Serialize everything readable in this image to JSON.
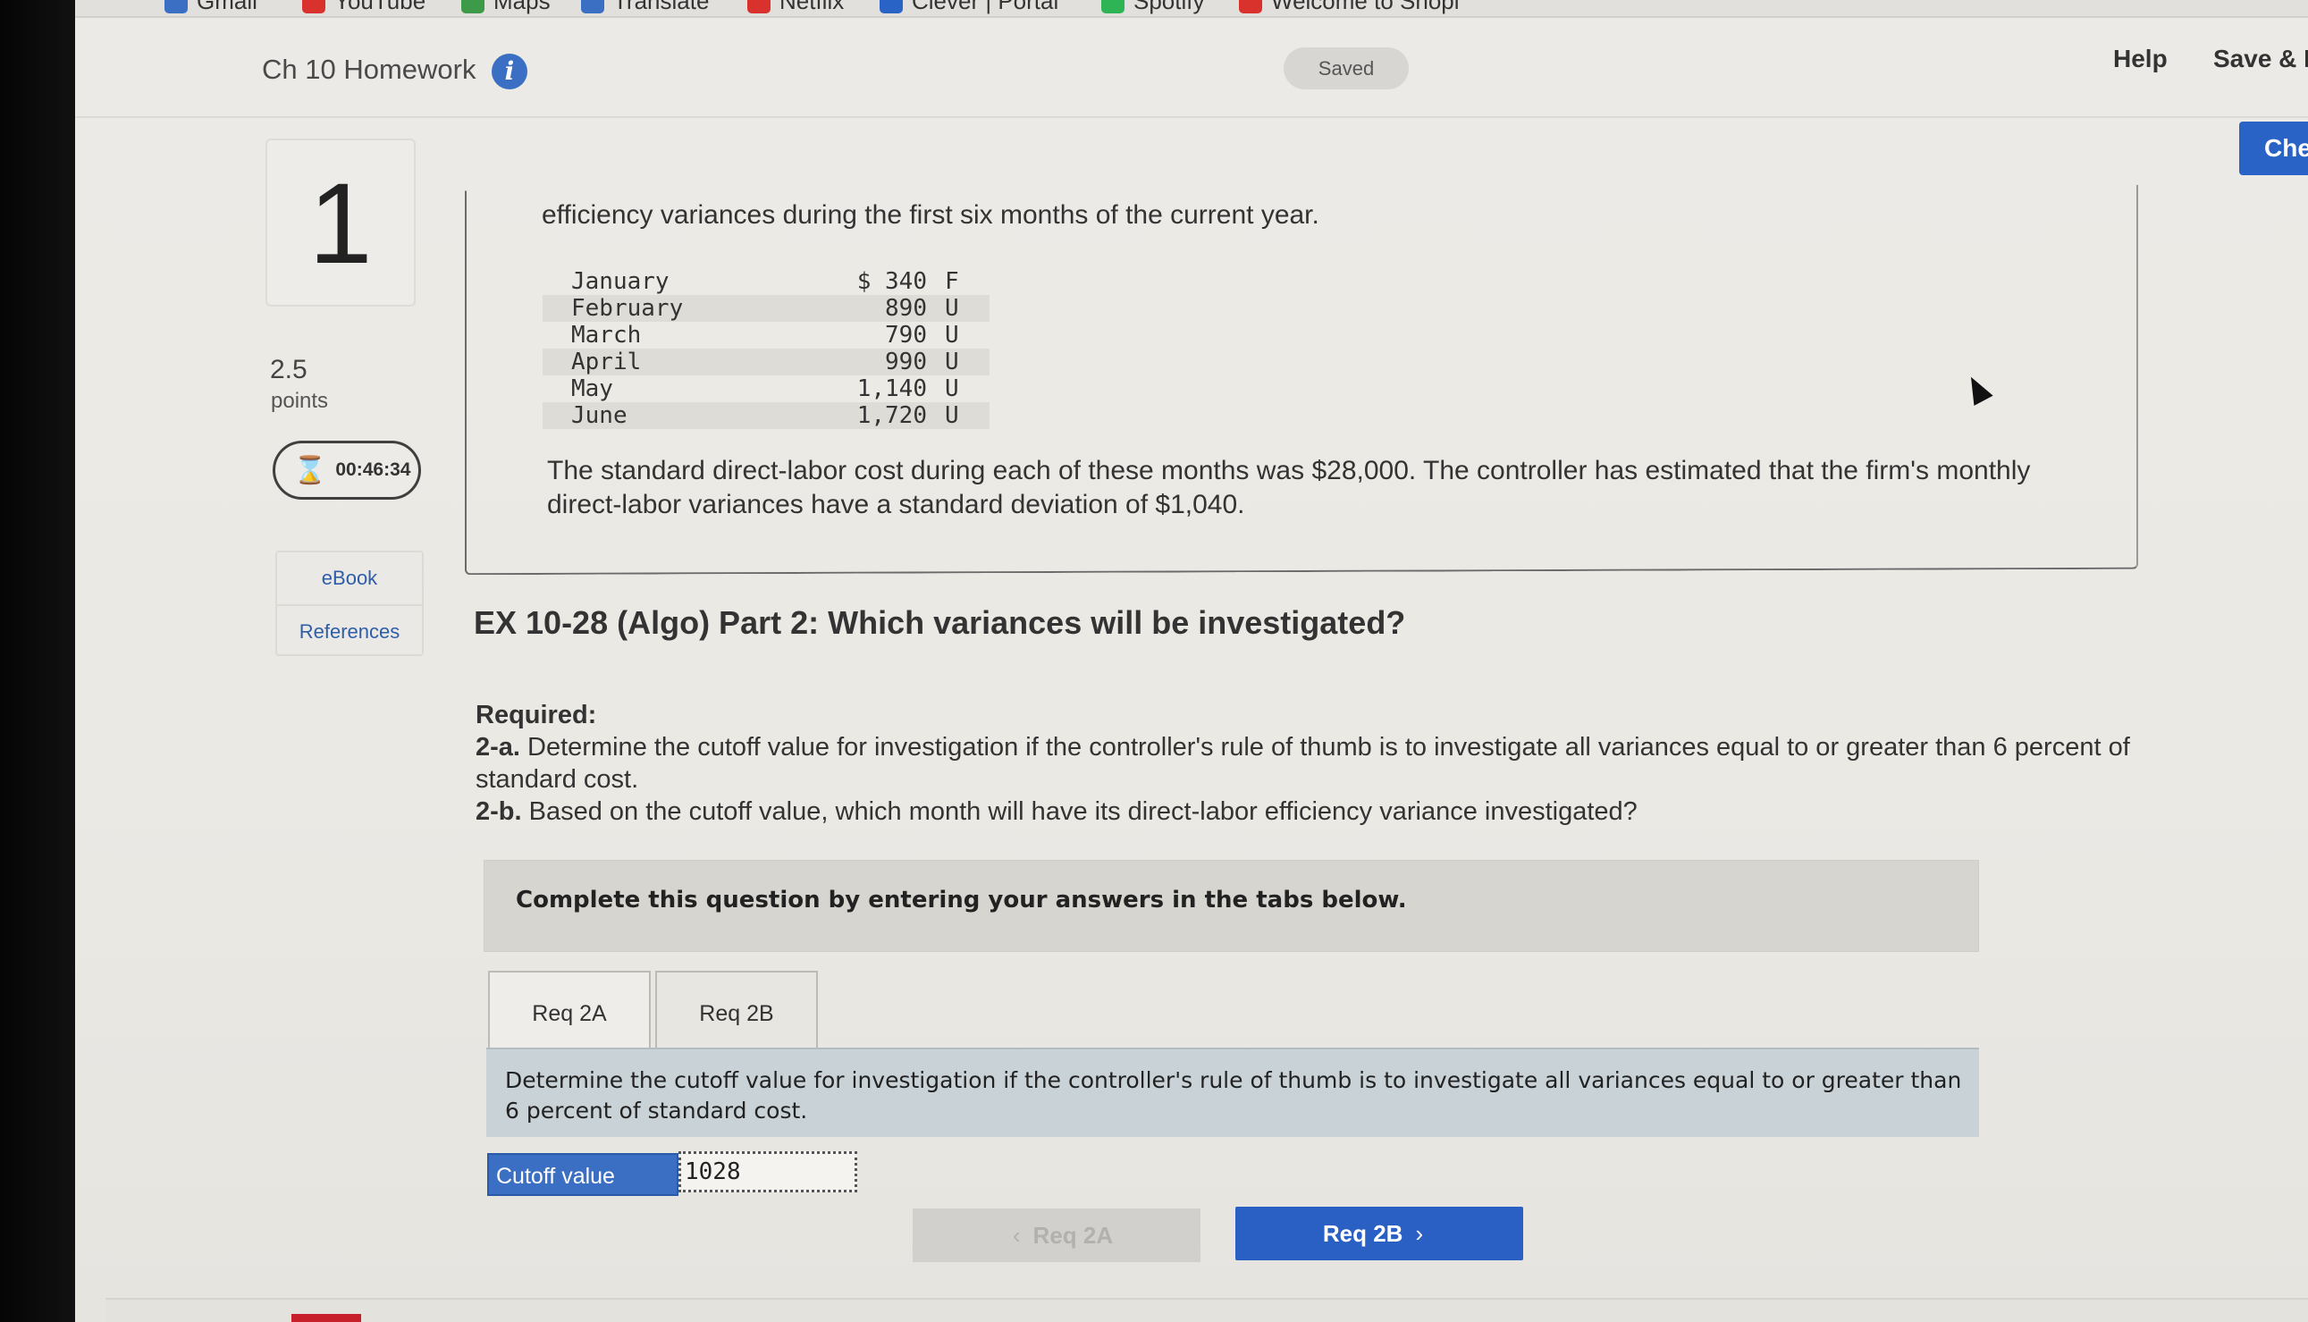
{
  "bookmarks": [
    {
      "label": "Gmail",
      "color": "#3a6fc4"
    },
    {
      "label": "YouTube",
      "color": "#d9322c"
    },
    {
      "label": "Maps",
      "color": "#3d9a48"
    },
    {
      "label": "Translate",
      "color": "#3a6fc4"
    },
    {
      "label": "Netflix",
      "color": "#d9322c"
    },
    {
      "label": "Clever | Portal",
      "color": "#2a63c6"
    },
    {
      "label": "Spotify",
      "color": "#2fb455"
    },
    {
      "label": "Welcome to Shopi",
      "color": "#d9322c"
    }
  ],
  "header": {
    "title": "Ch 10 Homework",
    "info_icon": "i",
    "saved_label": "Saved",
    "help_label": "Help",
    "save_exit_label": "Save & E",
    "check_label": "Che"
  },
  "sidebar": {
    "question_number": "1",
    "points_value": "2.5",
    "points_label": "points",
    "timer": "00:46:34",
    "links": [
      "eBook",
      "References"
    ]
  },
  "problem": {
    "intro": "efficiency variances during the first six months of the current year.",
    "variances": [
      {
        "month": "January",
        "amount": "$ 340",
        "code": "F"
      },
      {
        "month": "February",
        "amount": "890",
        "code": "U"
      },
      {
        "month": "March",
        "amount": "790",
        "code": "U"
      },
      {
        "month": "April",
        "amount": "990",
        "code": "U"
      },
      {
        "month": "May",
        "amount": "1,140",
        "code": "U"
      },
      {
        "month": "June",
        "amount": "1,720",
        "code": "U"
      }
    ],
    "standard_text": "The standard direct-labor cost during each of these months was $28,000. The controller has estimated that the firm's monthly direct-labor variances have a standard deviation of $1,040."
  },
  "part": {
    "title": "EX 10-28 (Algo) Part 2: Which variances will be investigated?",
    "required_label": "Required:",
    "req_2a_label": "2-a.",
    "req_2a_text": "Determine the cutoff value for investigation if the controller's rule of thumb is to investigate all variances equal to or greater than 6 percent of standard cost.",
    "req_2b_label": "2-b.",
    "req_2b_text": "Based on the cutoff value, which month will have its direct-labor efficiency variance investigated?"
  },
  "tabs_section": {
    "instruction": "Complete this question by entering your answers in the tabs below.",
    "tabs": [
      "Req 2A",
      "Req 2B"
    ],
    "panel_text": "Determine the cutoff value for investigation if the controller's rule of thumb is to investigate all variances equal to or greater than 6 percent of standard cost.",
    "cutoff_label": "Cutoff value",
    "cutoff_value": "1028"
  },
  "navigation": {
    "prev_label": "Req 2A",
    "next_label": "Req 2B"
  }
}
